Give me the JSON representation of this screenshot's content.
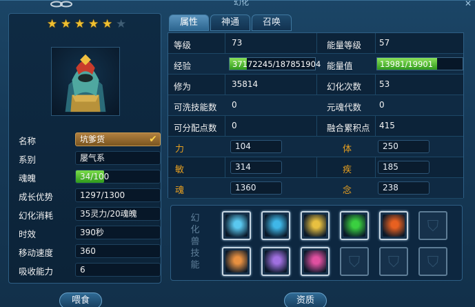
{
  "window": {
    "title": "幻化"
  },
  "left": {
    "stars": {
      "filled": 5,
      "total": 6
    },
    "fields": [
      {
        "label": "名称",
        "value": "坑爹货"
      },
      {
        "label": "系别",
        "value": "屡气系"
      },
      {
        "label": "魂魄",
        "value": "34/100"
      },
      {
        "label": "成长优势",
        "value": "1297/1300"
      },
      {
        "label": "幻化消耗",
        "value": "35灵力/20魂魄"
      },
      {
        "label": "时效",
        "value": "390秒"
      },
      {
        "label": "移动速度",
        "value": "360"
      },
      {
        "label": "吸收能力",
        "value": "6"
      }
    ],
    "soul_fraction": 0.34,
    "feed_button": "喂食"
  },
  "tabs": [
    {
      "label": "属性"
    },
    {
      "label": "神通"
    },
    {
      "label": "召唤"
    }
  ],
  "stats": {
    "rows": [
      {
        "l1": "等级",
        "v1": "73",
        "l2": "能量等级",
        "v2": "57"
      },
      {
        "l1": "经验",
        "v1": "37172245/187851904",
        "l2": "能量值",
        "v2": "13981/19901"
      },
      {
        "l1": "修为",
        "v1": "35814",
        "l2": "幻化次数",
        "v2": "53"
      },
      {
        "l1": "可洗技能数",
        "v1": "0",
        "l2": "元魂代数",
        "v2": "0"
      },
      {
        "l1": "可分配点数",
        "v1": "0",
        "l2": "融合累积点",
        "v2": "415"
      },
      {
        "l1": "力",
        "v1": "104",
        "l2": "体",
        "v2": "250"
      },
      {
        "l1": "敏",
        "v1": "314",
        "l2": "疾",
        "v2": "185"
      },
      {
        "l1": "魂",
        "v1": "1360",
        "l2": "念",
        "v2": "238"
      }
    ],
    "exp_fraction": 0.198,
    "energy_fraction": 0.703
  },
  "skills": {
    "title": "幻化兽技能",
    "slots": [
      {
        "icon": "wind-vortex-icon",
        "color": "#5ac8f0"
      },
      {
        "icon": "water-swirl-icon",
        "color": "#3fb7e8"
      },
      {
        "icon": "golden-strike-icon",
        "color": "#e8c040"
      },
      {
        "icon": "green-slash-icon",
        "color": "#3ad040"
      },
      {
        "icon": "fire-claw-icon",
        "color": "#e86020"
      },
      {
        "icon": "empty-shield-icon",
        "color": ""
      },
      {
        "icon": "rune-burst-icon",
        "color": "#e89040"
      },
      {
        "icon": "purple-mask-icon",
        "color": "#a070e0"
      },
      {
        "icon": "pink-flame-icon",
        "color": "#e050a0"
      },
      {
        "icon": "empty-shield-icon",
        "color": ""
      },
      {
        "icon": "empty-shield-icon",
        "color": ""
      },
      {
        "icon": "empty-shield-icon",
        "color": ""
      }
    ]
  },
  "bottom": {
    "qualification_button": "资质"
  }
}
